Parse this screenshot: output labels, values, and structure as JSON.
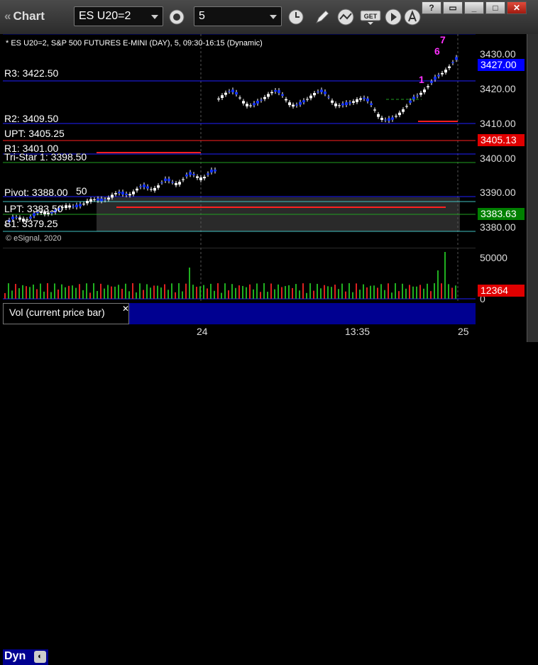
{
  "window": {
    "title": "Chart",
    "symbol_value": "ES U20=2",
    "interval_value": "5",
    "controls": [
      "help",
      "restore",
      "minimize",
      "maximize",
      "close"
    ]
  },
  "chart": {
    "info_line": "* ES U20=2, S&P 500 FUTURES E-MINI (DAY), 5, 09:30-16:15 (Dynamic)",
    "copyright": "© eSignal, 2020",
    "price_axis": [
      "3430.00",
      "3420.00",
      "3410.00",
      "3400.00",
      "3390.00",
      "3380.00"
    ],
    "tags": {
      "last": "3427.00",
      "red": "3405.13",
      "green": "3383.63",
      "last_color": "#0000ff",
      "red_color": "#e00000",
      "green_color": "#008000"
    },
    "levels": {
      "r3": "R3: 3422.50",
      "r2": "R2: 3409.50",
      "upt": "UPT: 3405.25",
      "r1": "R1: 3401.00",
      "tristar": "Tri-Star 1: 3398.50",
      "pivot": "Pivot: 3388.00",
      "lpt": "LPT: 3383.50",
      "s1": "S1: 3379.25",
      "fifty": "50"
    },
    "counts": {
      "top": "7",
      "six": "6",
      "one": "1"
    }
  },
  "volume": {
    "label": "Vol (current price bar)",
    "axis_top": "50000",
    "axis_zero": "0",
    "tag": "12364"
  },
  "time_axis": [
    "24",
    "13:35",
    "25"
  ],
  "footer": {
    "dyn": "Dyn"
  }
}
